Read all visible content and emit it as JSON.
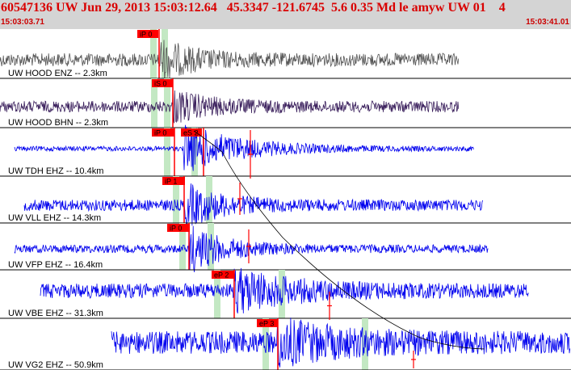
{
  "header": {
    "title": "60547136 UW Jun 29, 2013 15:03:12.64   45.3347 -121.6745  5.6 0.35 Md le amyw UW 01    4",
    "start_time": "15:03:03.71",
    "end_time": "15:03:41.01"
  },
  "colors": {
    "header_bg": "#d4d4d4",
    "title": "#d90000",
    "pick": "#ff0000",
    "theoretical_window": "#c3e8c3",
    "trace_dark": "#555555",
    "trace_purple": "#3a1f5c",
    "trace_blue": "#0000ee",
    "separator": "#000000"
  },
  "traces": [
    {
      "label": "UW HOOD ENZ -- 2.3km",
      "color": "dark",
      "picks": [
        {
          "label": "iP 0"
        }
      ],
      "green_windows": 2
    },
    {
      "label": "UW HOOD BHN -- 2.3km",
      "color": "purple",
      "picks": [
        {
          "label": "iS 0"
        }
      ],
      "green_windows": 2
    },
    {
      "label": "UW TDH EHZ -- 10.4km",
      "color": "blue",
      "picks": [
        {
          "label": "iP 0"
        },
        {
          "label": "eS 2"
        }
      ],
      "green_windows": 2
    },
    {
      "label": "UW VLL EHZ -- 14.3km",
      "color": "blue",
      "picks": [
        {
          "label": "iP 1"
        }
      ],
      "green_windows": 2
    },
    {
      "label": "UW VFP EHZ -- 16.4km",
      "color": "blue",
      "picks": [
        {
          "label": "iP 0"
        }
      ],
      "green_windows": 2
    },
    {
      "label": "UW VBE EHZ -- 31.3km",
      "color": "blue",
      "picks": [
        {
          "label": "eP 2"
        }
      ],
      "green_windows": 2
    },
    {
      "label": "UW VG2 EHZ -- 50.9km",
      "color": "blue",
      "picks": [
        {
          "label": "eP 3"
        }
      ],
      "green_windows": 2
    }
  ]
}
